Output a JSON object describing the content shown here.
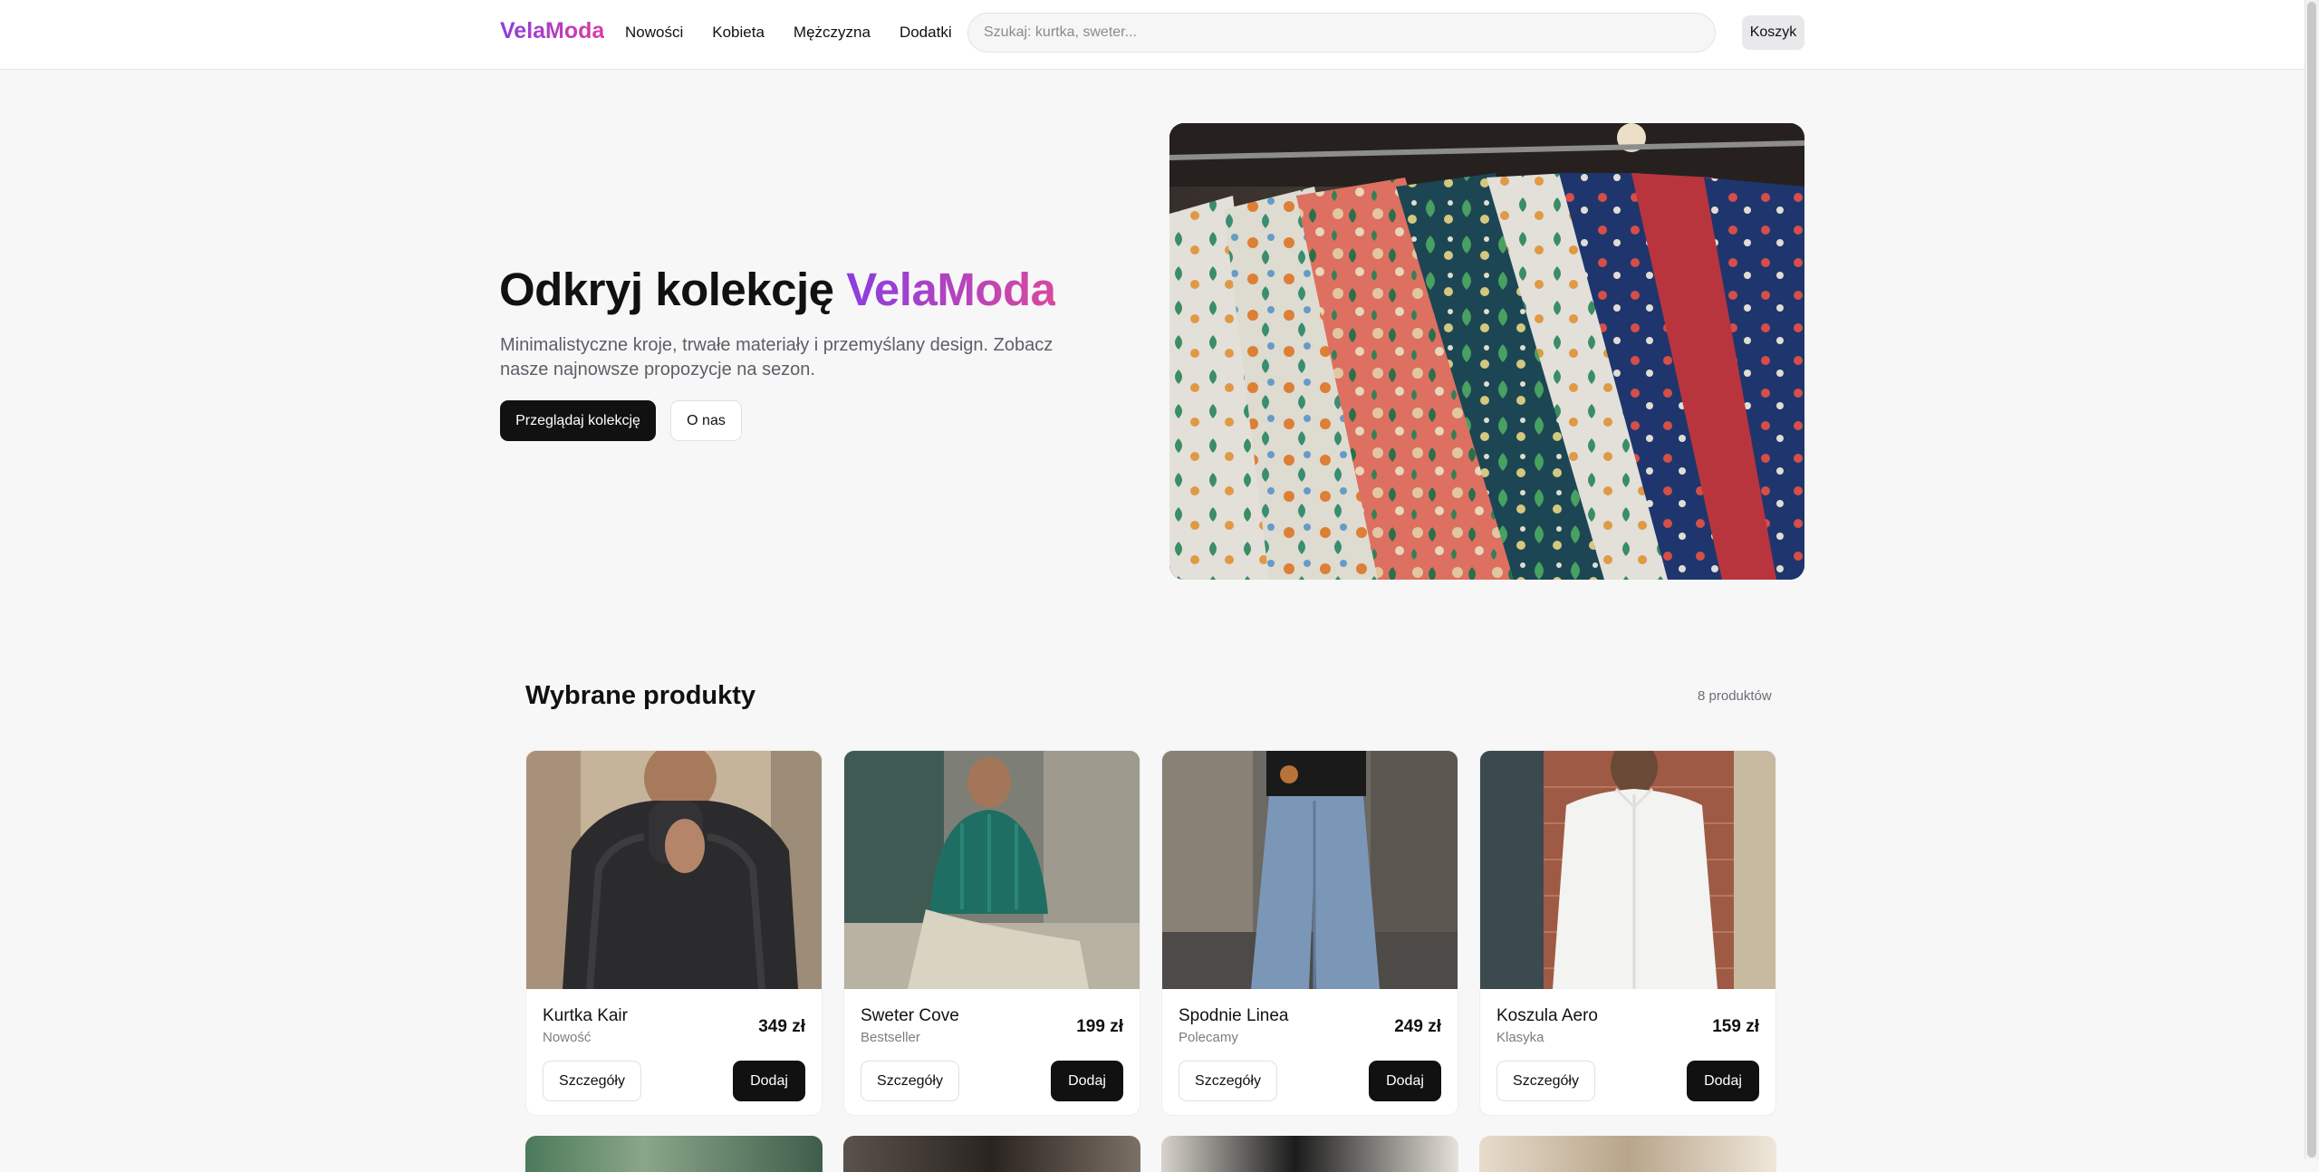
{
  "header": {
    "logo": "VelaModa",
    "nav": [
      "Nowości",
      "Kobieta",
      "Mężczyzna",
      "Dodatki"
    ],
    "search_placeholder": "Szukaj: kurtka, sweter...",
    "search_value": "",
    "cart_label": "Koszyk"
  },
  "hero": {
    "title_prefix": "Odkryj kolekcję ",
    "title_brand": "VelaModa",
    "description": "Minimalistyczne kroje, trwałe materiały i przemyślany design. Zobacz nasze najnowsze propozycje na sezon.",
    "primary_button": "Przeglądaj kolekcję",
    "secondary_button": "O nas"
  },
  "products_section": {
    "title": "Wybrane produkty",
    "count": "8 produktów",
    "details_label": "Szczegóły",
    "add_label": "Dodaj",
    "items": [
      {
        "name": "Kurtka Kair",
        "tag": "Nowość",
        "price": "349 zł"
      },
      {
        "name": "Sweter Cove",
        "tag": "Bestseller",
        "price": "199 zł"
      },
      {
        "name": "Spodnie Linea",
        "tag": "Polecamy",
        "price": "249 zł"
      },
      {
        "name": "Koszula Aero",
        "tag": "Klasyka",
        "price": "159 zł"
      }
    ]
  },
  "colors": {
    "accent_start": "#8a3ee0",
    "accent_end": "#d9489f",
    "primary_button": "#111111",
    "page_background": "#f7f7f8"
  },
  "icons": {}
}
